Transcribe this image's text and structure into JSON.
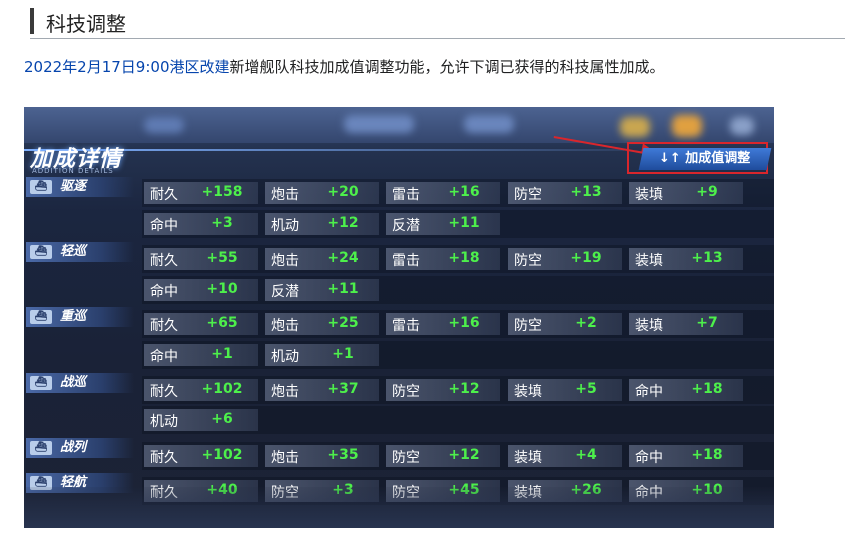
{
  "section": {
    "title": "科技调整"
  },
  "note": {
    "link_text": "2022年2月17日9:00港区改建",
    "text": "新增舰队科技加成值调整功能，允许下调已获得的科技属性加成。"
  },
  "game": {
    "panel_title": "加成详情",
    "panel_subtitle": "ADDITION DETAILS",
    "adjust_button": "↓↑ 加成值调整",
    "categories": [
      {
        "label": "驱逐",
        "icon": "destroyer-icon"
      },
      {
        "label": "轻巡",
        "icon": "light-cruiser-icon"
      },
      {
        "label": "重巡",
        "icon": "heavy-cruiser-icon"
      },
      {
        "label": "战巡",
        "icon": "battlecruiser-icon"
      },
      {
        "label": "战列",
        "icon": "battleship-icon"
      },
      {
        "label": "轻航",
        "icon": "light-carrier-icon"
      }
    ],
    "rows": [
      [
        {
          "name": "耐久",
          "value": "+158"
        },
        {
          "name": "炮击",
          "value": "+20"
        },
        {
          "name": "雷击",
          "value": "+16"
        },
        {
          "name": "防空",
          "value": "+13"
        },
        {
          "name": "装填",
          "value": "+9"
        }
      ],
      [
        {
          "name": "命中",
          "value": "+3"
        },
        {
          "name": "机动",
          "value": "+12"
        },
        {
          "name": "反潜",
          "value": "+11"
        }
      ],
      [
        {
          "name": "耐久",
          "value": "+55"
        },
        {
          "name": "炮击",
          "value": "+24"
        },
        {
          "name": "雷击",
          "value": "+18"
        },
        {
          "name": "防空",
          "value": "+19"
        },
        {
          "name": "装填",
          "value": "+13"
        }
      ],
      [
        {
          "name": "命中",
          "value": "+10"
        },
        {
          "name": "反潜",
          "value": "+11"
        }
      ],
      [
        {
          "name": "耐久",
          "value": "+65"
        },
        {
          "name": "炮击",
          "value": "+25"
        },
        {
          "name": "雷击",
          "value": "+16"
        },
        {
          "name": "防空",
          "value": "+2"
        },
        {
          "name": "装填",
          "value": "+7"
        }
      ],
      [
        {
          "name": "命中",
          "value": "+1"
        },
        {
          "name": "机动",
          "value": "+1"
        }
      ],
      [
        {
          "name": "耐久",
          "value": "+102"
        },
        {
          "name": "炮击",
          "value": "+37"
        },
        {
          "name": "防空",
          "value": "+12"
        },
        {
          "name": "装填",
          "value": "+5"
        },
        {
          "name": "命中",
          "value": "+18"
        }
      ],
      [
        {
          "name": "机动",
          "value": "+6"
        }
      ],
      [
        {
          "name": "耐久",
          "value": "+102"
        },
        {
          "name": "炮击",
          "value": "+35"
        },
        {
          "name": "防空",
          "value": "+12"
        },
        {
          "name": "装填",
          "value": "+4"
        },
        {
          "name": "命中",
          "value": "+18"
        }
      ],
      [
        {
          "name": "耐久",
          "value": "+40"
        },
        {
          "name": "防空",
          "value": "+3"
        },
        {
          "name": "防空",
          "value": "+45"
        },
        {
          "name": "装填",
          "value": "+26"
        },
        {
          "name": "命中",
          "value": "+10"
        }
      ]
    ]
  }
}
